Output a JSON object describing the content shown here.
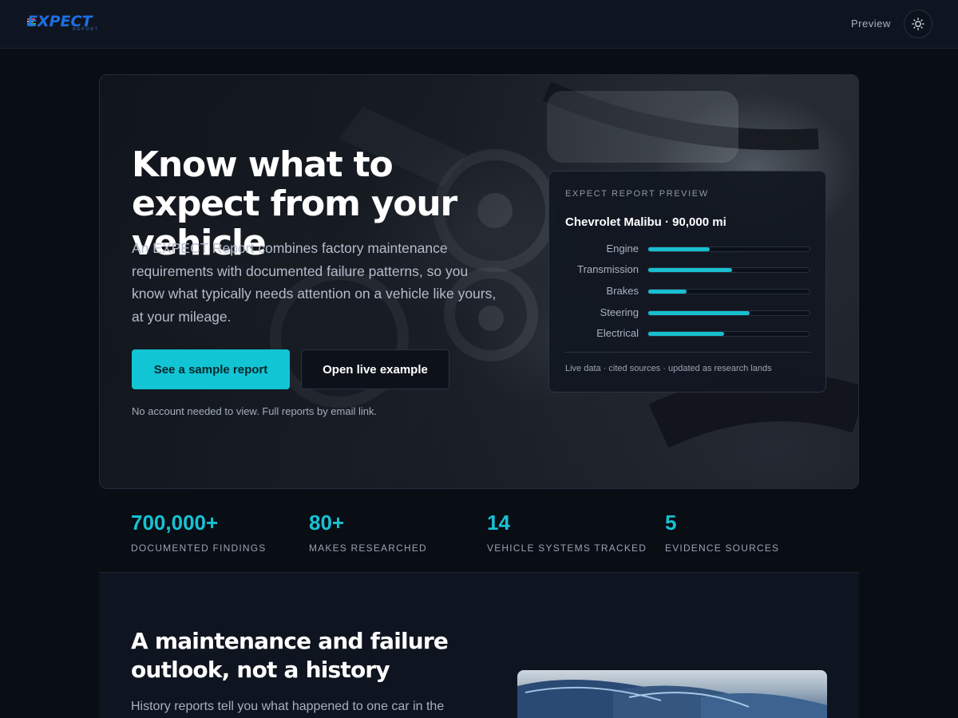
{
  "header": {
    "logo_text": "EXPECT",
    "logo_sub": "REPORT",
    "preview_label": "Preview",
    "theme_icon": "sun-icon"
  },
  "hero": {
    "title": "Know what to expect from your vehicle",
    "description": "An EXPECT Report combines factory maintenance requirements with documented failure patterns, so you know what typically needs attention on a vehicle like yours, at your mileage.",
    "primary_button": "See a sample report",
    "secondary_button": "Open live example",
    "note": "No account needed to view. Full reports by email link."
  },
  "report_card": {
    "eyebrow": "EXPECT REPORT PREVIEW",
    "vehicle": "Chevrolet Malibu · 90,000 mi",
    "systems": [
      {
        "label": "Engine",
        "level": 0.38
      },
      {
        "label": "Transmission",
        "level": 0.52
      },
      {
        "label": "Brakes",
        "level": 0.24
      },
      {
        "label": "Steering",
        "level": 0.63
      },
      {
        "label": "Electrical",
        "level": 0.47
      }
    ],
    "footer": "Live data · cited sources · updated as research lands",
    "accent_color": "#18bfd0"
  },
  "stats": [
    {
      "value": "700,000+",
      "label": "DOCUMENTED FINDINGS"
    },
    {
      "value": "80+",
      "label": "MAKES RESEARCHED"
    },
    {
      "value": "14",
      "label": "VEHICLE SYSTEMS TRACKED"
    },
    {
      "value": "5",
      "label": "EVIDENCE SOURCES"
    }
  ],
  "section2": {
    "title": "A maintenance and failure outlook, not a history",
    "text": "History reports tell you what happened to one car in the"
  },
  "colors": {
    "accent": "#11c5d4",
    "background": "#090d14",
    "logo_blue": "#1e6fe0"
  }
}
